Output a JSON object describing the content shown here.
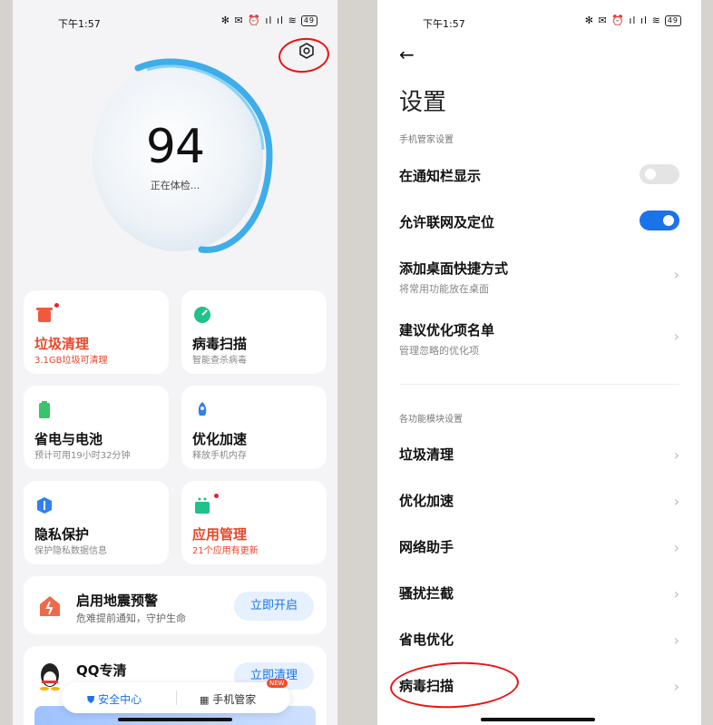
{
  "left": {
    "status": {
      "time": "下午1:57",
      "icons": "✻ ✉ ⏰ ıl ıl ≋",
      "battery": "49"
    },
    "score": "94",
    "checking": "正在体检...",
    "cards": [
      {
        "title": "垃圾清理",
        "sub": "3.1GB垃圾可清理"
      },
      {
        "title": "病毒扫描",
        "sub": "智能查杀病毒"
      },
      {
        "title": "省电与电池",
        "sub": "预计可用19小时32分钟"
      },
      {
        "title": "优化加速",
        "sub": "释放手机内存"
      },
      {
        "title": "隐私保护",
        "sub": "保护隐私数据信息"
      },
      {
        "title": "应用管理",
        "sub": "21个应用有更新"
      }
    ],
    "quake": {
      "title": "启用地震预警",
      "sub": "危难提前通知，守护生命",
      "button": "立即开启"
    },
    "qq": {
      "title": "QQ专清",
      "button": "立即清理"
    },
    "bottom": {
      "tab1": "安全中心",
      "tab2": "手机管家",
      "badge": "NEW"
    }
  },
  "right": {
    "status": {
      "time": "下午1:57",
      "icons": "✻ ✉ ⏰ ıl ıl ≋",
      "battery": "49"
    },
    "back": "←",
    "title": "设置",
    "section1": "手机管家设置",
    "toggles": [
      {
        "label": "在通知栏显示",
        "on": false
      },
      {
        "label": "允许联网及定位",
        "on": true
      }
    ],
    "links": [
      {
        "label": "添加桌面快捷方式",
        "sub": "将常用功能放在桌面"
      },
      {
        "label": "建议优化项名单",
        "sub": "管理忽略的优化项"
      }
    ],
    "section2": "各功能模块设置",
    "modules": [
      "垃圾清理",
      "优化加速",
      "网络助手",
      "骚扰拦截",
      "省电优化",
      "病毒扫描"
    ],
    "chevron": "›"
  },
  "colors": {
    "accent": "#1a73e8",
    "orange": "#e8472a",
    "annotation": "#e11111"
  }
}
